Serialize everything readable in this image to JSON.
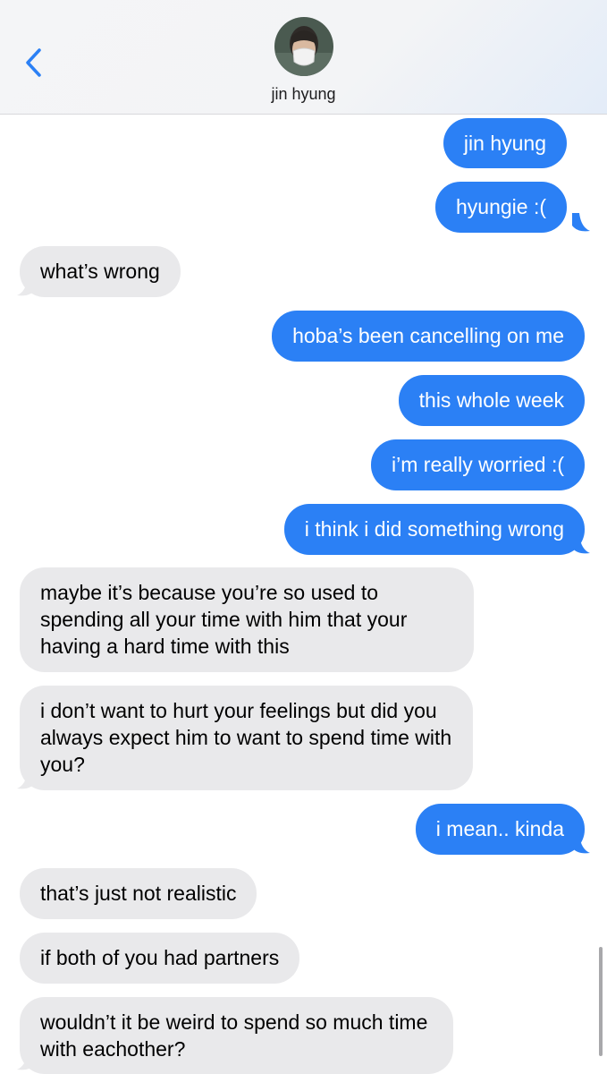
{
  "header": {
    "contact_name": "jin hyung",
    "avatar_icon": "contact-avatar-photo",
    "back_icon": "chevron-left-icon",
    "accent_color": "#2b80f5"
  },
  "messages": [
    {
      "direction": "outgoing",
      "text": "jin hyung"
    },
    {
      "direction": "outgoing",
      "text": "hyungie :("
    },
    {
      "direction": "incoming",
      "text": "what’s wrong"
    },
    {
      "direction": "outgoing",
      "text": "hoba’s been cancelling on me"
    },
    {
      "direction": "outgoing",
      "text": "this whole week"
    },
    {
      "direction": "outgoing",
      "text": "i’m really worried :("
    },
    {
      "direction": "outgoing",
      "text": "i think i did something wrong"
    },
    {
      "direction": "incoming",
      "text": "maybe it’s because you’re so used to spending all your time with him that your having a hard time with this"
    },
    {
      "direction": "incoming",
      "text": "i don’t want to hurt your feelings but did you always expect him to want to spend time with you?"
    },
    {
      "direction": "outgoing",
      "text": "i mean.. kinda"
    },
    {
      "direction": "incoming",
      "text": "that’s just not realistic"
    },
    {
      "direction": "incoming",
      "text": "if both of you had partners"
    },
    {
      "direction": "incoming",
      "text": "wouldn’t it be weird to spend so much time with eachother?"
    }
  ],
  "colors": {
    "outgoing_bubble": "#2b80f5",
    "incoming_bubble": "#e9e9eb",
    "incoming_text": "#000000",
    "outgoing_text": "#ffffff"
  }
}
